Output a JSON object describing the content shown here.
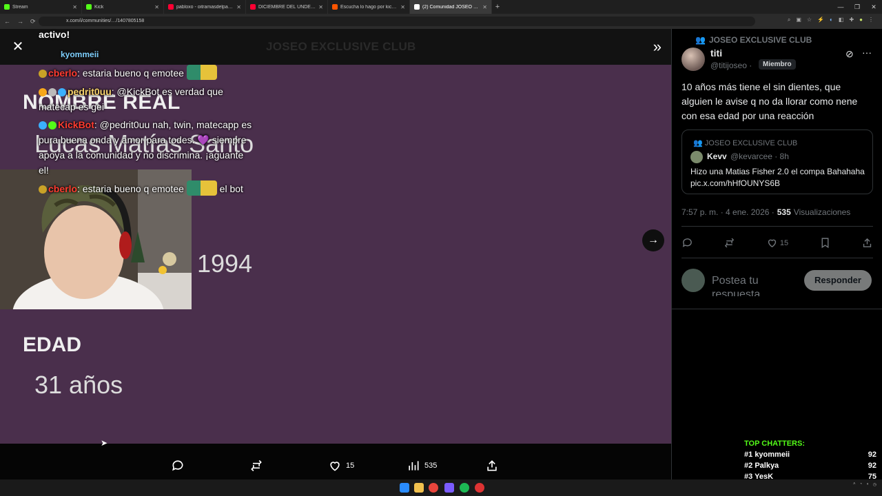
{
  "browser": {
    "tabs": [
      {
        "title": "Stream",
        "color": "#53fc18"
      },
      {
        "title": "Kick",
        "color": "#53fc18"
      },
      {
        "title": "pabloxo - oitramasdelpablo",
        "color": "#ff0033"
      },
      {
        "title": "DICIEMBRE DEL UNDER ARGEN",
        "color": "#ff0033"
      },
      {
        "title": "Escucha lo hago por kick de m",
        "color": "#ff5500"
      },
      {
        "title": "(2) Comunidad JOSEO EXCLUSI",
        "color": "#ffffff"
      }
    ],
    "url": "x.com/i/communities/…/1407805158"
  },
  "overlay": {
    "activo": "activo!",
    "top_user": "kyommeii"
  },
  "chat": [
    {
      "user": "cberlo",
      "user_color": "red",
      "text": ": estaria bueno q emotee"
    },
    {
      "user": "pedrit0uu",
      "user_color": "gold",
      "text": ": @KickBot es verdad que matecap es gei"
    },
    {
      "user": "KickBot",
      "user_color": "red",
      "text": ": @pedrit0uu nah, twin, matecapp es pura buena onda y amor para todes. 💜 siempre apoya a la comunidad y no discrimina. ¡aguante el!"
    },
    {
      "user": "cberlo",
      "user_color": "red",
      "text": ": estaria bueno q emotee",
      "suffix": " el bot"
    }
  ],
  "viewer": {
    "ghost_title": "JOSEO EXCLUSIVE CLUB",
    "label_nombre": "NOMBRE REAL",
    "value_nombre": "Lucas Matías Santo",
    "value_year": "1994",
    "label_edad": "EDAD",
    "value_edad": "31 años",
    "replies": "",
    "likes": "15",
    "views": "535"
  },
  "post": {
    "community": "JOSEO EXCLUSIVE CLUB",
    "display_name": "titi",
    "handle": "@titijoseo ·",
    "member_badge": "Miembro",
    "text": "10 años más tiene el sin dientes, que alguien le avise q no da llorar como nene con esa edad por una reacción",
    "quote": {
      "community": "JOSEO EXCLUSIVE CLUB",
      "name": "Kevv",
      "handle": "@kevarcee · 8h",
      "text": "Hizo una Matias Fisher 2.0 el compa Bahahaha pic.x.com/hHfOUNYS6B"
    },
    "timestamp": "7:57 p. m. · 4 ene. 2026 ·",
    "views": "535",
    "views_label": "Visualizaciones",
    "likes": "15",
    "reply_placeholder": "Postea tu respuesta",
    "reply_button": "Responder"
  },
  "top_chatters": {
    "header": "TOP CHATTERS:",
    "rows": [
      {
        "rank": "#1",
        "name": "kyommeii",
        "count": "92"
      },
      {
        "rank": "#2",
        "name": "Palkya",
        "count": "92"
      },
      {
        "rank": "#3",
        "name": "YesK",
        "count": "75"
      }
    ]
  }
}
